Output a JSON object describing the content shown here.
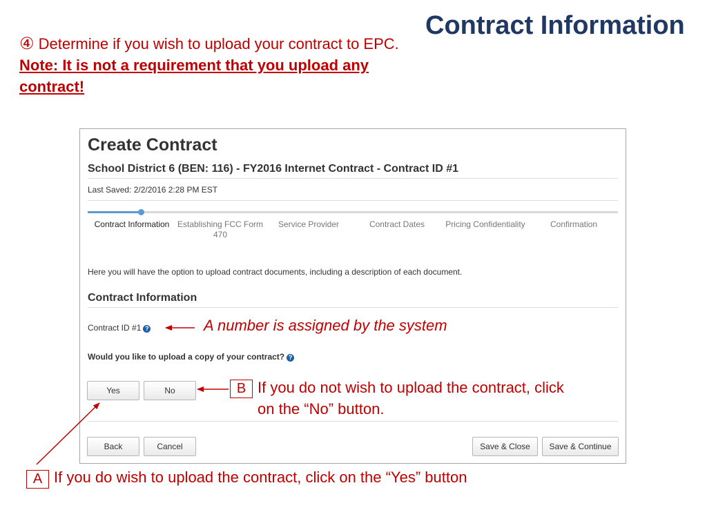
{
  "slide": {
    "title": "Contract Information",
    "step_marker": "④",
    "step_text": " Determine if you wish to upload your contract to EPC. ",
    "step_note": "Note: It is not a requirement that you upload any contract!"
  },
  "panel": {
    "title": "Create Contract",
    "subtitle": "School District 6 (BEN: 116) - FY2016 Internet Contract - Contract ID #1",
    "last_saved": "Last Saved: 2/2/2016 2:28 PM EST",
    "progress": 0.1,
    "steps": [
      {
        "label": "Contract Information",
        "active": true
      },
      {
        "label": "Establishing FCC Form 470",
        "active": false
      },
      {
        "label": "Service Provider",
        "active": false
      },
      {
        "label": "Contract Dates",
        "active": false
      },
      {
        "label": "Pricing Confidentiality",
        "active": false
      },
      {
        "label": "Confirmation",
        "active": false
      }
    ],
    "intro": "Here you will have the option to upload contract documents, including a description of each document.",
    "section_title": "Contract Information",
    "contract_id_label": "Contract ID #1",
    "upload_question": "Would you like to upload a copy of your contract?",
    "help_icon_glyph": "?",
    "buttons": {
      "yes": "Yes",
      "no": "No",
      "back": "Back",
      "cancel": "Cancel",
      "save_close": "Save & Close",
      "save_continue": "Save & Continue"
    }
  },
  "annotations": {
    "contract_id_note": "A number is assigned by the system",
    "b_letter": "B",
    "b_text_line1": "If you do not wish to upload the contract, click",
    "b_text_line2": "on the “No” button.",
    "a_letter": "A",
    "a_text": "If you do wish to upload the contract, click on the “Yes” button"
  },
  "colors": {
    "title": "#1f3864",
    "annotation_red": "#c00000",
    "progress_blue": "#5b9bd5",
    "help_icon_blue": "#1f5fa8"
  }
}
